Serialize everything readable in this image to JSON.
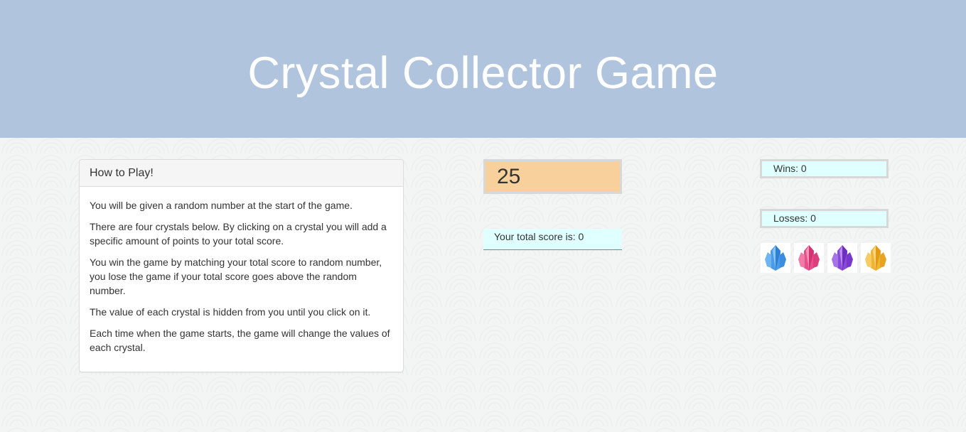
{
  "header": {
    "title": "Crystal Collector Game"
  },
  "instructions": {
    "heading": "How to Play!",
    "paragraphs": [
      "You will be given a random number at the start of the game.",
      "There are four crystals below. By clicking on a crystal you will add a specific amount of points to your total score.",
      "You win the game by matching your total score to random number, you lose the game if your total score goes above the random number.",
      "The value of each crystal is hidden from you until you click on it.",
      "Each time when the game starts, the game will change the values of each crystal."
    ]
  },
  "game": {
    "target_number": "25",
    "total_score_text": "Your total score is: 0",
    "wins_text": "Wins: 0",
    "losses_text": "Losses: 0"
  },
  "crystals": [
    {
      "icon": "blue-crystal-icon",
      "color": "#4a9be8"
    },
    {
      "icon": "pink-crystal-icon",
      "color": "#e8508c"
    },
    {
      "icon": "purple-crystal-icon",
      "color": "#8a4ad8"
    },
    {
      "icon": "yellow-crystal-icon",
      "color": "#f0b632"
    }
  ],
  "colors": {
    "header_bg": "#b0c4de",
    "target_bg": "#f8d09c",
    "score_bg": "#e0ffff"
  }
}
